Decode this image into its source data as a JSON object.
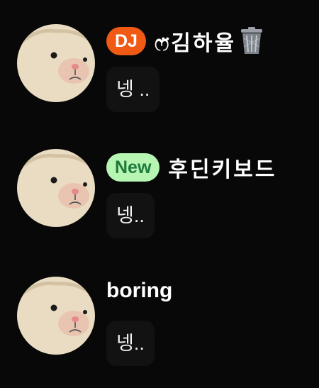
{
  "messages": [
    {
      "badge": "DJ",
      "badge_color": "#f05a14",
      "badge_text_color": "#ffffff",
      "username": "ෆ̈김하율",
      "name_suffix_icon": "trash-can-icon",
      "text": "넹 .."
    },
    {
      "badge": "New",
      "badge_color": "#b6f5b2",
      "badge_text_color": "#1f7a3c",
      "username": "후딘키보드",
      "text": "넹.."
    },
    {
      "username": "boring",
      "text": "넹.."
    }
  ],
  "avatar_icon": "hamster-face-icon"
}
